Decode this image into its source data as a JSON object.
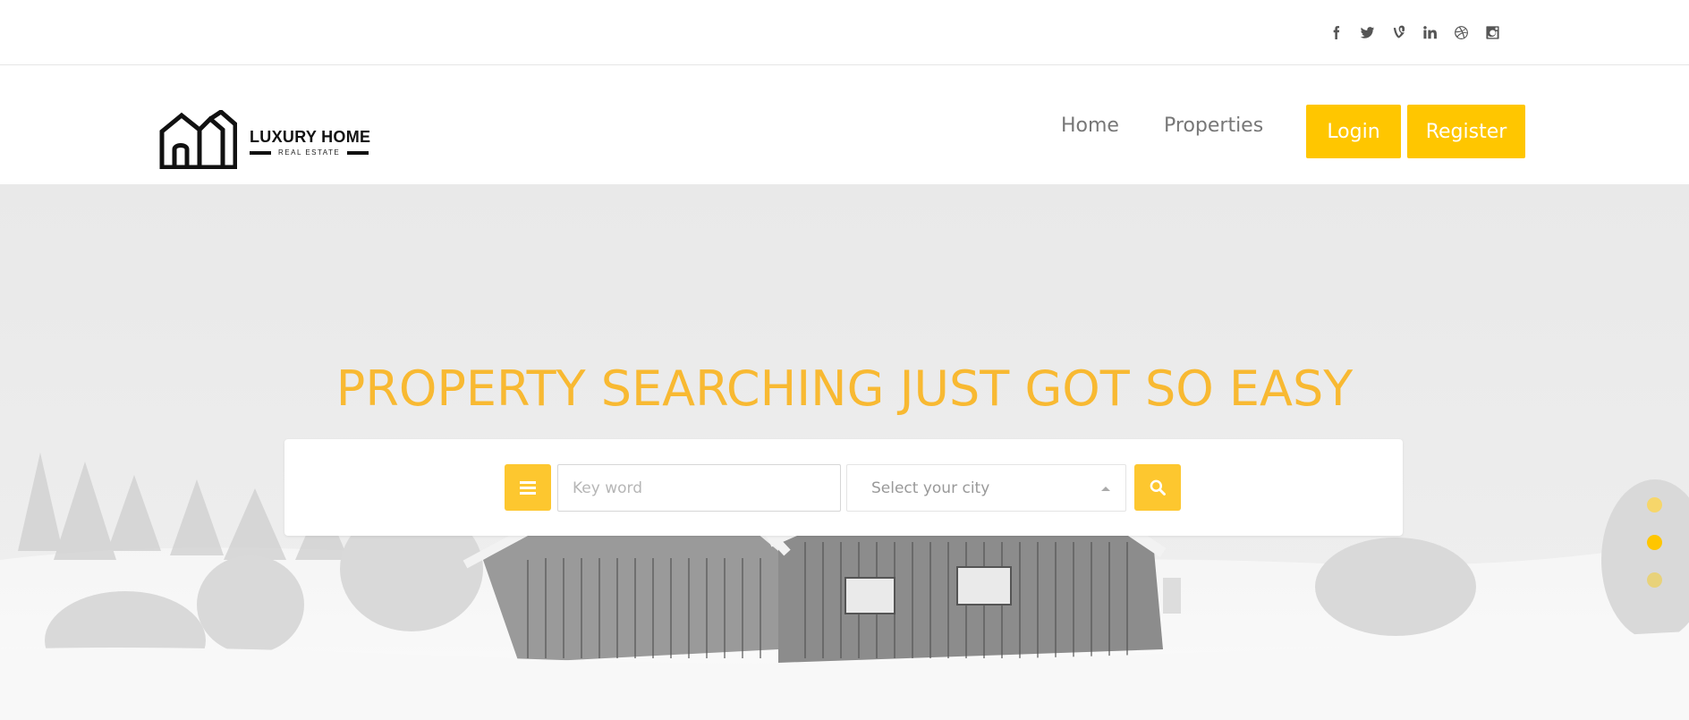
{
  "social": {
    "icons": [
      "facebook-icon",
      "twitter-icon",
      "vine-icon",
      "linkedin-icon",
      "dribbble-icon",
      "instagram-icon"
    ]
  },
  "logo": {
    "title": "LUXURY HOME",
    "subtitle": "REAL ESTATE"
  },
  "nav": {
    "home": "Home",
    "properties": "Properties",
    "login": "Login",
    "register": "Register"
  },
  "hero": {
    "headline": "PROPERTY SEARCHING JUST GOT SO EASY",
    "keyword_placeholder": "Key word",
    "city_placeholder": "Select your city"
  },
  "colors": {
    "accent": "#ffc600",
    "headline": "#f8b932"
  },
  "slider": {
    "active_index": 1,
    "count": 3
  }
}
